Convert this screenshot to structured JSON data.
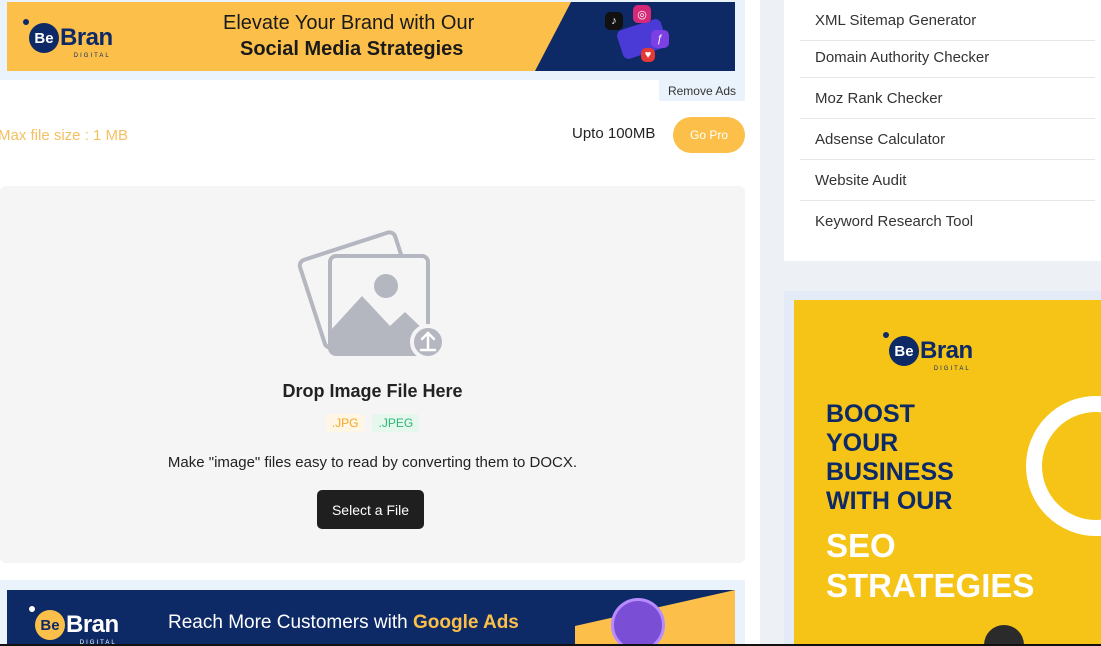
{
  "top_ad": {
    "brand_be": "Be",
    "brand_bran": "Bran",
    "brand_sub": "DIGITAL",
    "line1": "Elevate Your Brand with Our",
    "line2": "Social Media Strategies"
  },
  "remove_ads": "Remove Ads",
  "upload": {
    "max_size": "Max file size : 1 MB",
    "upto": "Upto 100MB",
    "go_pro": "Go Pro",
    "drop_title": "Drop Image File Here",
    "formats": [
      ".JPG",
      ".JPEG"
    ],
    "description": "Make \"image\" files easy to read by converting them to DOCX.",
    "select_button": "Select a File"
  },
  "bottom_ad": {
    "brand_be": "Be",
    "brand_bran": "Bran",
    "brand_sub": "DIGITAL",
    "text_prefix": "Reach More Customers with ",
    "text_highlight": "Google Ads"
  },
  "sidebar_tools": [
    "XML Sitemap Generator",
    "Domain Authority Checker",
    "Moz Rank Checker",
    "Adsense Calculator",
    "Website Audit",
    "Keyword Research Tool"
  ],
  "side_ad": {
    "brand_be": "Be",
    "brand_bran": "Bran",
    "brand_sub": "DIGITAL",
    "headline_lines": [
      "BOOST",
      "YOUR",
      "BUSINESS",
      "WITH OUR"
    ],
    "highlight_lines": [
      "SEO",
      "STRATEGIES"
    ]
  },
  "colors": {
    "brand_navy": "#0d2a66",
    "brand_yellow": "#fcc04a",
    "side_ad_yellow": "#f6c417"
  }
}
